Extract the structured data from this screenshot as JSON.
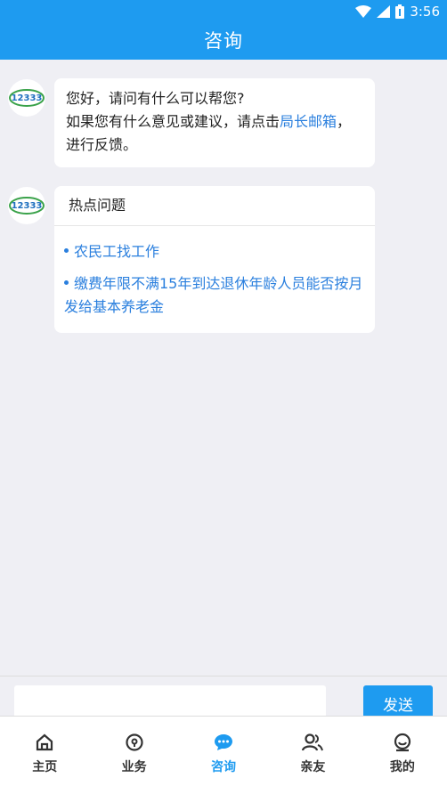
{
  "status_bar": {
    "time": "3:56"
  },
  "header": {
    "title": "咨询"
  },
  "messages": {
    "greeting": {
      "line1": "您好，请问有什么可以帮您?",
      "line2_prefix": "如果您有什么意见或建议，请点击",
      "link": "局长邮箱",
      "line2_suffix": "，进行反馈。"
    },
    "hot": {
      "title": "热点问题",
      "items": [
        "农民工找工作",
        "缴费年限不满15年到达退休年龄人员能否按月发给基本养老金"
      ]
    }
  },
  "input": {
    "placeholder": "",
    "send_label": "发送"
  },
  "tabs": [
    {
      "label": "主页",
      "icon": "home-icon"
    },
    {
      "label": "业务",
      "icon": "location-pin-icon"
    },
    {
      "label": "咨询",
      "icon": "chat-icon",
      "active": true
    },
    {
      "label": "亲友",
      "icon": "people-icon"
    },
    {
      "label": "我的",
      "icon": "profile-icon"
    }
  ],
  "colors": {
    "primary": "#1e9bf0",
    "link": "#2a7fde",
    "background": "#efeff4"
  },
  "avatar": {
    "text": "12333"
  }
}
